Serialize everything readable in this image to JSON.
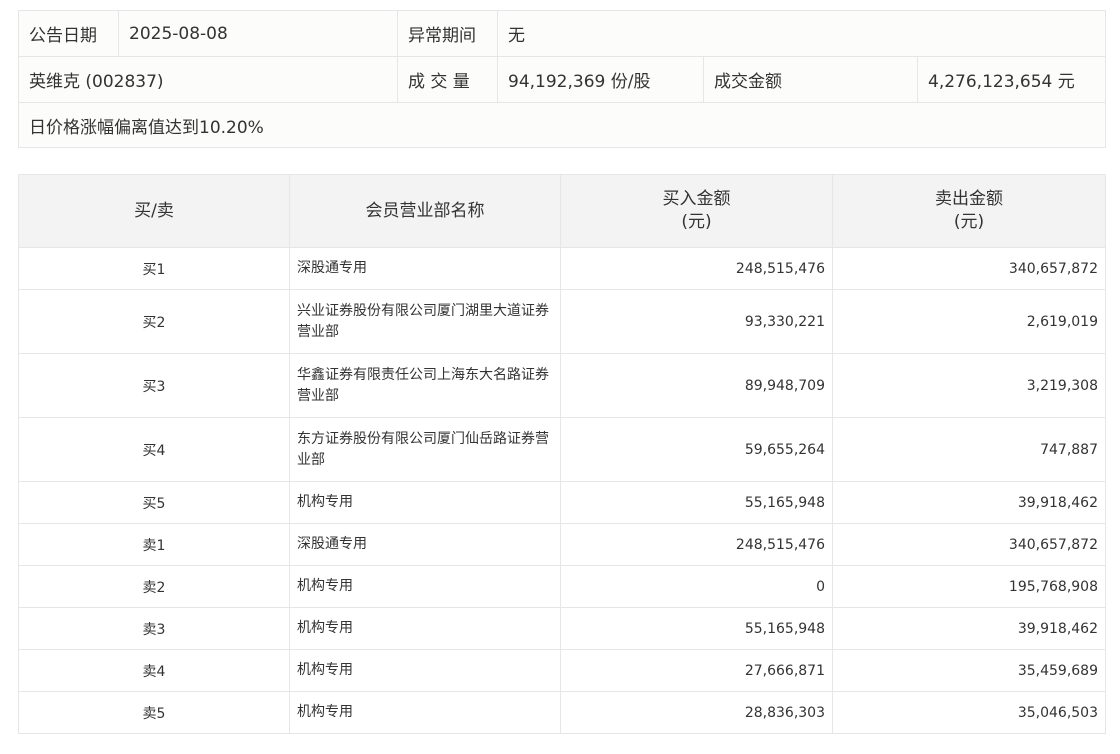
{
  "info": {
    "announce_date_label": "公告日期",
    "announce_date_value": "2025-08-08",
    "abnormal_period_label": "异常期间",
    "abnormal_period_value": "无",
    "stock_name": "英维克 (002837)",
    "volume_label": "成 交 量",
    "volume_value": "94,192,369 份/股",
    "turnover_label": "成交金额",
    "turnover_value": "4,276,123,654 元",
    "reason": "日价格涨幅偏离值达到10.20%"
  },
  "detail": {
    "headers": {
      "side": "买/卖",
      "name": "会员营业部名称",
      "buy_line1": "买入金额",
      "buy_line2": "(元)",
      "sell_line1": "卖出金额",
      "sell_line2": "(元)"
    },
    "rows": [
      {
        "side": "买1",
        "name": "深股通专用",
        "buy": "248,515,476",
        "sell": "340,657,872"
      },
      {
        "side": "买2",
        "name": "兴业证券股份有限公司厦门湖里大道证券营业部",
        "buy": "93,330,221",
        "sell": "2,619,019"
      },
      {
        "side": "买3",
        "name": "华鑫证券有限责任公司上海东大名路证券营业部",
        "buy": "89,948,709",
        "sell": "3,219,308"
      },
      {
        "side": "买4",
        "name": "东方证券股份有限公司厦门仙岳路证券营业部",
        "buy": "59,655,264",
        "sell": "747,887"
      },
      {
        "side": "买5",
        "name": "机构专用",
        "buy": "55,165,948",
        "sell": "39,918,462"
      },
      {
        "side": "卖1",
        "name": "深股通专用",
        "buy": "248,515,476",
        "sell": "340,657,872"
      },
      {
        "side": "卖2",
        "name": "机构专用",
        "buy": "0",
        "sell": "195,768,908"
      },
      {
        "side": "卖3",
        "name": "机构专用",
        "buy": "55,165,948",
        "sell": "39,918,462"
      },
      {
        "side": "卖4",
        "name": "机构专用",
        "buy": "27,666,871",
        "sell": "35,459,689"
      },
      {
        "side": "卖5",
        "name": "机构专用",
        "buy": "28,836,303",
        "sell": "35,046,503"
      }
    ]
  }
}
